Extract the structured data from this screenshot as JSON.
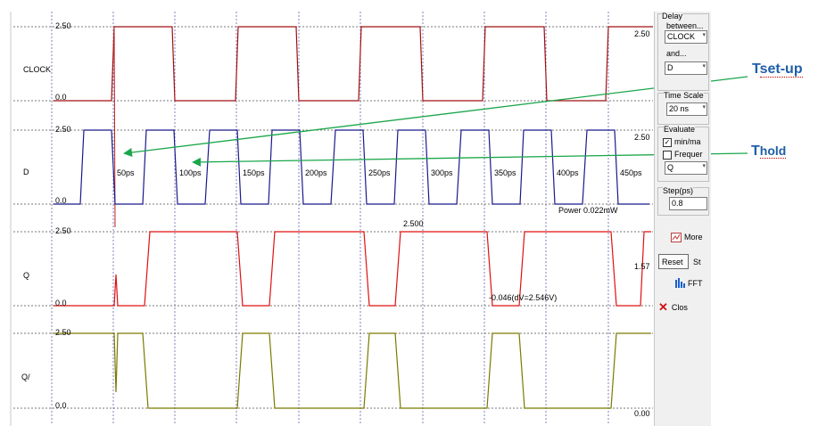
{
  "signals": [
    {
      "name": "CLOCK",
      "high_label": "2.50",
      "low_label": "0.0",
      "right_label": "2.50",
      "color": "#a01010"
    },
    {
      "name": "D",
      "high_label": "2.50",
      "low_label": "0.0",
      "right_label": "2.50",
      "color": "#1a1a8c"
    },
    {
      "name": "Q",
      "high_label": "2.50",
      "low_label": "0.0",
      "right_label": "1.57",
      "color": "#e01010"
    },
    {
      "name": "Q/",
      "high_label": "2.50",
      "low_label": "0.0",
      "right_label": "0.00",
      "color": "#7a7a00"
    }
  ],
  "time_markers": [
    "50ps",
    "100ps",
    "150ps",
    "200ps",
    "250ps",
    "300ps",
    "350ps",
    "400ps",
    "450ps"
  ],
  "readouts": {
    "power": "Power 0.022mW",
    "q_peak": "2.500",
    "cursor": "-0.046(dV=2.546V)"
  },
  "panel": {
    "delay_title": "Delay",
    "between_label": "between...",
    "between_value": "CLOCK",
    "and_label": "and...",
    "and_value": "D",
    "time_scale_title": "Time Scale",
    "time_scale_value": "20 ns",
    "evaluate_title": "Evaluate",
    "minmax_label": "min/ma",
    "minmax_checked": true,
    "frequency_label": "Frequer",
    "frequency_checked": false,
    "eval_signal": "Q",
    "step_title": "Step(ps)",
    "step_value": "0.8",
    "more_label": "More",
    "reset_label": "Reset",
    "stop_label": "St",
    "fft_label": "FFT",
    "close_label": "Clos"
  },
  "annotations": {
    "setup_prefix": "T",
    "setup_suffix": "set-up",
    "hold_prefix": "T",
    "hold_suffix": "hold"
  },
  "colors": {
    "arrow": "#1aa64a",
    "grid": "#8080c0",
    "accent_blue": "#1f5fa8"
  }
}
